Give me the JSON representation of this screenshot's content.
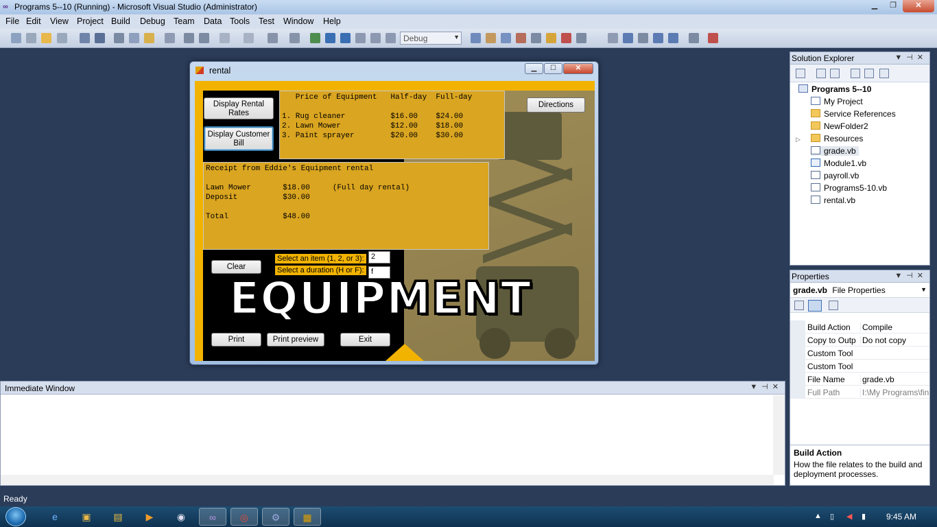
{
  "titlebar": {
    "title": "Programs 5--10 (Running) - Microsoft Visual Studio (Administrator)"
  },
  "menu": [
    "File",
    "Edit",
    "View",
    "Project",
    "Build",
    "Debug",
    "Team",
    "Data",
    "Tools",
    "Test",
    "Window",
    "Help"
  ],
  "toolbar": {
    "config": "Debug"
  },
  "status": {
    "text": "Ready"
  },
  "taskbar": {
    "clock": "9:45 AM"
  },
  "solution_explorer": {
    "title": "Solution Explorer",
    "project": "Programs 5--10",
    "items": [
      "My Project",
      "Service References",
      "NewFolder2",
      "Resources",
      "grade.vb",
      "Module1.vb",
      "payroll.vb",
      "Programs5-10.vb",
      "rental.vb"
    ],
    "selected": "grade.vb"
  },
  "properties": {
    "title": "Properties",
    "object_name": "grade.vb",
    "object_type": "File Properties",
    "rows": [
      {
        "name": "Build Action",
        "value": "Compile"
      },
      {
        "name": "Copy to Outp",
        "value": "Do not copy"
      },
      {
        "name": "Custom Tool",
        "value": ""
      },
      {
        "name": "Custom Tool",
        "value": ""
      },
      {
        "name": "File Name",
        "value": "grade.vb"
      },
      {
        "name": "Full Path",
        "value": "I:\\My Programs\\fin"
      }
    ],
    "desc_title": "Build Action",
    "desc_text": "How the file relates to the build and deployment processes."
  },
  "immediate": {
    "title": "Immediate Window"
  },
  "rental": {
    "title": "rental",
    "btn_rates": "Display Rental Rates",
    "btn_bill": "Display Customer Bill",
    "btn_directions": "Directions",
    "btn_clear": "Clear",
    "btn_print": "Print",
    "btn_preview": "Print preview",
    "btn_exit": "Exit",
    "rates_text": "   Price of Equipment   Half-day  Full-day\n\n1. Rug cleaner          $16.00    $24.00\n2. Lawn Mower           $12.00    $18.00\n3. Paint sprayer        $20.00    $30.00",
    "receipt_text": "Receipt from Eddie's Equipment rental\n\nLawn Mower       $18.00     (Full day rental)\nDeposit          $30.00\n\nTotal            $48.00",
    "label_item": "Select an item (1, 2, or 3):",
    "label_duration": "Select a duration (H or F):",
    "value_item": "2",
    "value_duration": "f",
    "logo": "EQUIPMENT"
  }
}
